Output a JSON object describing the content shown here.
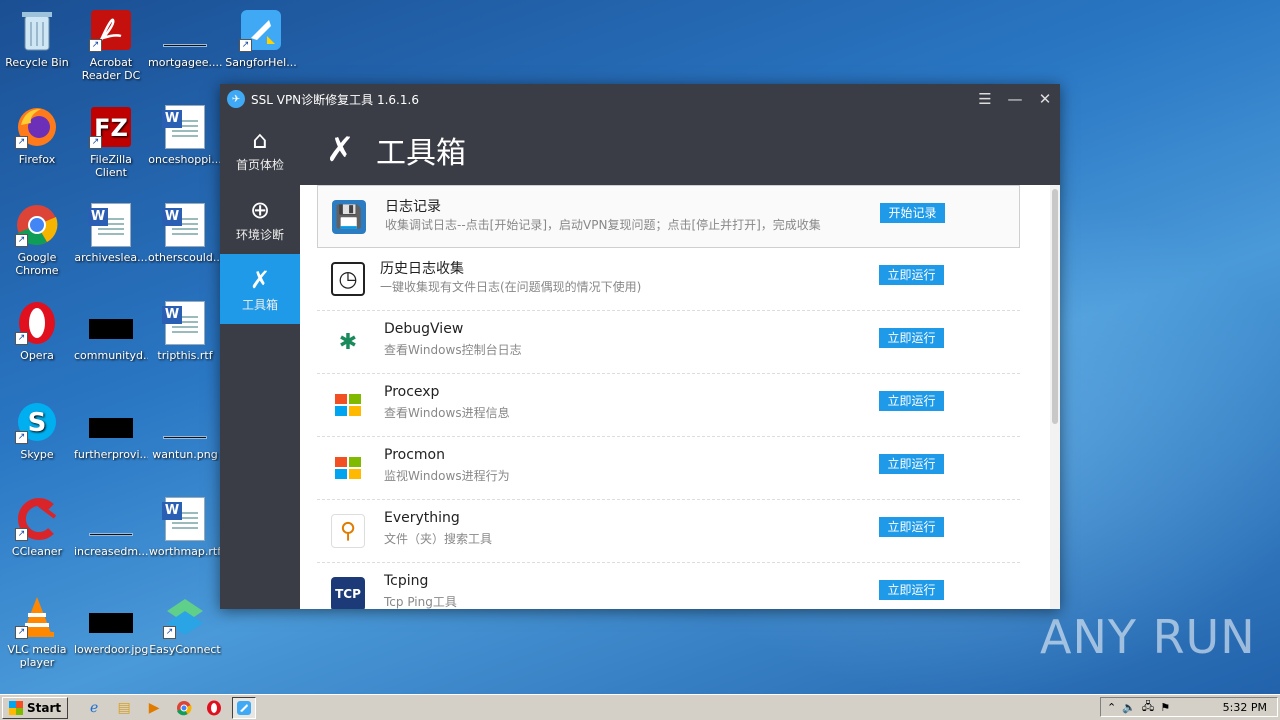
{
  "desktop": {
    "icons": [
      {
        "label": "Recycle Bin",
        "icon": "recycle-bin-icon"
      },
      {
        "label": "Acrobat Reader DC",
        "icon": "acrobat-icon"
      },
      {
        "label": "mortgagee....",
        "icon": "file-thumbnail-icon"
      },
      {
        "label": "SangforHel...",
        "icon": "sangfor-icon"
      },
      {
        "label": "Firefox",
        "icon": "firefox-icon"
      },
      {
        "label": "FileZilla Client",
        "icon": "filezilla-icon"
      },
      {
        "label": "onceshoppi...",
        "icon": "word-doc-icon"
      },
      {
        "label": "Google Chrome",
        "icon": "chrome-icon"
      },
      {
        "label": "archiveslea...",
        "icon": "word-doc-icon"
      },
      {
        "label": "otherscould...",
        "icon": "word-doc-icon"
      },
      {
        "label": "Opera",
        "icon": "opera-icon"
      },
      {
        "label": "communityd...",
        "icon": "image-thumbnail-icon"
      },
      {
        "label": "tripthis.rtf",
        "icon": "word-doc-icon"
      },
      {
        "label": "Skype",
        "icon": "skype-icon"
      },
      {
        "label": "furtherprovi...",
        "icon": "image-thumbnail-icon"
      },
      {
        "label": "wantun.png",
        "icon": "image-thumbnail-icon"
      },
      {
        "label": "CCleaner",
        "icon": "ccleaner-icon"
      },
      {
        "label": "increasedm...",
        "icon": "file-thumbnail-icon"
      },
      {
        "label": "worthmap.rtf",
        "icon": "word-doc-icon"
      },
      {
        "label": "VLC media player",
        "icon": "vlc-icon"
      },
      {
        "label": "lowerdoor.jpg",
        "icon": "image-thumbnail-icon"
      },
      {
        "label": "EasyConnect",
        "icon": "easyconnect-icon"
      }
    ],
    "watermark": "ANY RUN"
  },
  "window": {
    "title": "SSL VPN诊断修复工具 1.6.1.6",
    "controls": {
      "menu": "☰",
      "minimize": "—",
      "close": "✕"
    },
    "sidebar": [
      {
        "label": "首页体检",
        "icon": "home-icon",
        "active": false
      },
      {
        "label": "环境诊断",
        "icon": "target-icon",
        "active": false
      },
      {
        "label": "工具箱",
        "icon": "tools-icon",
        "active": true
      }
    ],
    "header": {
      "title": "工具箱",
      "icon": "tools-icon"
    },
    "tools": [
      {
        "name": "日志记录",
        "desc": "收集调试日志--点击[开始记录]，启动VPN复现问题；点击[停止并打开]，完成收集",
        "button": "开始记录",
        "icon": "floppy-log-icon"
      },
      {
        "name": "历史日志收集",
        "desc": "一键收集现有文件日志(在问题偶现的情况下使用)",
        "button": "立即运行",
        "icon": "clipboard-clock-icon"
      },
      {
        "name": "DebugView",
        "desc": "查看Windows控制台日志",
        "button": "立即运行",
        "icon": "bug-icon"
      },
      {
        "name": "Procexp",
        "desc": "查看Windows进程信息",
        "button": "立即运行",
        "icon": "windows-icon"
      },
      {
        "name": "Procmon",
        "desc": "监视Windows进程行为",
        "button": "立即运行",
        "icon": "windows-icon"
      },
      {
        "name": "Everything",
        "desc": "文件（夹）搜索工具",
        "button": "立即运行",
        "icon": "search-icon"
      },
      {
        "name": "Tcping",
        "desc": "Tcp Ping工具",
        "button": "立即运行",
        "icon": "tcp-icon"
      }
    ]
  },
  "taskbar": {
    "start": "Start",
    "apps": [
      {
        "icon": "ie-icon"
      },
      {
        "icon": "explorer-icon"
      },
      {
        "icon": "media-player-icon"
      },
      {
        "icon": "chrome-icon"
      },
      {
        "icon": "opera-icon"
      },
      {
        "icon": "sangfor-icon"
      }
    ],
    "time": "5:32 PM"
  }
}
